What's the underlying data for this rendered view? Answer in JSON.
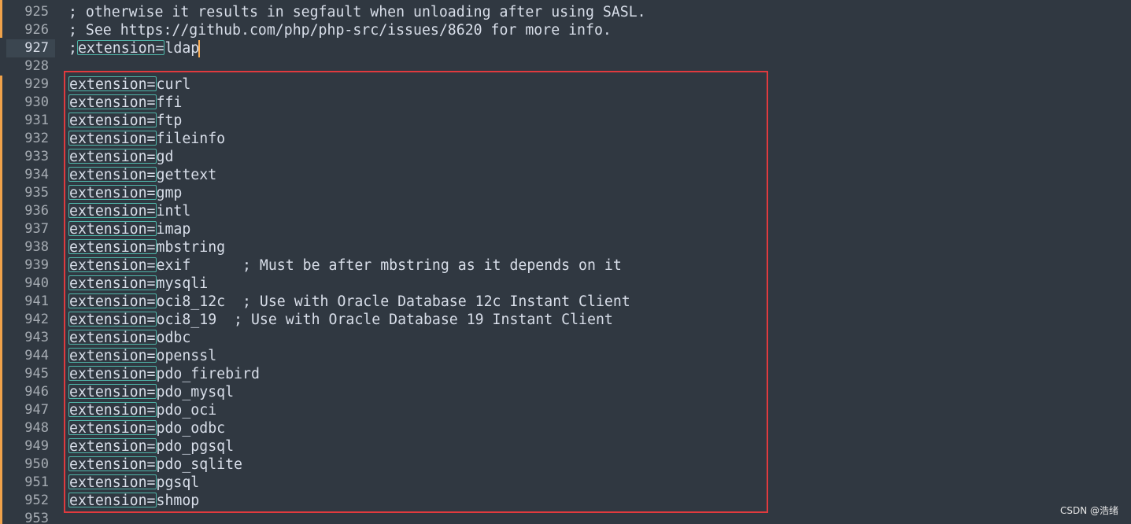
{
  "colors": {
    "background": "#303841",
    "text": "#d8dee9",
    "line_number": "#a6acb3",
    "word_highlight_border": "#4fb4a8",
    "annotation_box": "#e03a3e",
    "modified_marker": "#f0a24a",
    "caret": "#f9ae58"
  },
  "editor": {
    "current_line": "927",
    "lines": [
      {
        "num": "925",
        "text": "; otherwise it results in segfault when unloading after using SASL.",
        "highlight": ""
      },
      {
        "num": "926",
        "text": "; See https://github.com/php/php-src/issues/8620 for more info.",
        "highlight": ""
      },
      {
        "num": "927",
        "prefix": ";",
        "highlight": "extension=",
        "rest": "ldap"
      },
      {
        "num": "928",
        "text": "",
        "highlight": ""
      },
      {
        "num": "929",
        "highlight": "extension=",
        "rest": "curl"
      },
      {
        "num": "930",
        "highlight": "extension=",
        "rest": "ffi"
      },
      {
        "num": "931",
        "highlight": "extension=",
        "rest": "ftp"
      },
      {
        "num": "932",
        "highlight": "extension=",
        "rest": "fileinfo"
      },
      {
        "num": "933",
        "highlight": "extension=",
        "rest": "gd"
      },
      {
        "num": "934",
        "highlight": "extension=",
        "rest": "gettext"
      },
      {
        "num": "935",
        "highlight": "extension=",
        "rest": "gmp"
      },
      {
        "num": "936",
        "highlight": "extension=",
        "rest": "intl"
      },
      {
        "num": "937",
        "highlight": "extension=",
        "rest": "imap"
      },
      {
        "num": "938",
        "highlight": "extension=",
        "rest": "mbstring"
      },
      {
        "num": "939",
        "highlight": "extension=",
        "rest": "exif      ; Must be after mbstring as it depends on it"
      },
      {
        "num": "940",
        "highlight": "extension=",
        "rest": "mysqli"
      },
      {
        "num": "941",
        "highlight": "extension=",
        "rest": "oci8_12c  ; Use with Oracle Database 12c Instant Client"
      },
      {
        "num": "942",
        "highlight": "extension=",
        "rest": "oci8_19  ; Use with Oracle Database 19 Instant Client"
      },
      {
        "num": "943",
        "highlight": "extension=",
        "rest": "odbc"
      },
      {
        "num": "944",
        "highlight": "extension=",
        "rest": "openssl"
      },
      {
        "num": "945",
        "highlight": "extension=",
        "rest": "pdo_firebird"
      },
      {
        "num": "946",
        "highlight": "extension=",
        "rest": "pdo_mysql"
      },
      {
        "num": "947",
        "highlight": "extension=",
        "rest": "pdo_oci"
      },
      {
        "num": "948",
        "highlight": "extension=",
        "rest": "pdo_odbc"
      },
      {
        "num": "949",
        "highlight": "extension=",
        "rest": "pdo_pgsql"
      },
      {
        "num": "950",
        "highlight": "extension=",
        "rest": "pdo_sqlite"
      },
      {
        "num": "951",
        "highlight": "extension=",
        "rest": "pgsql"
      },
      {
        "num": "952",
        "highlight": "extension=",
        "rest": "shmop"
      },
      {
        "num": "953",
        "text": "",
        "highlight": ""
      }
    ]
  },
  "watermark": "CSDN @浩绪"
}
